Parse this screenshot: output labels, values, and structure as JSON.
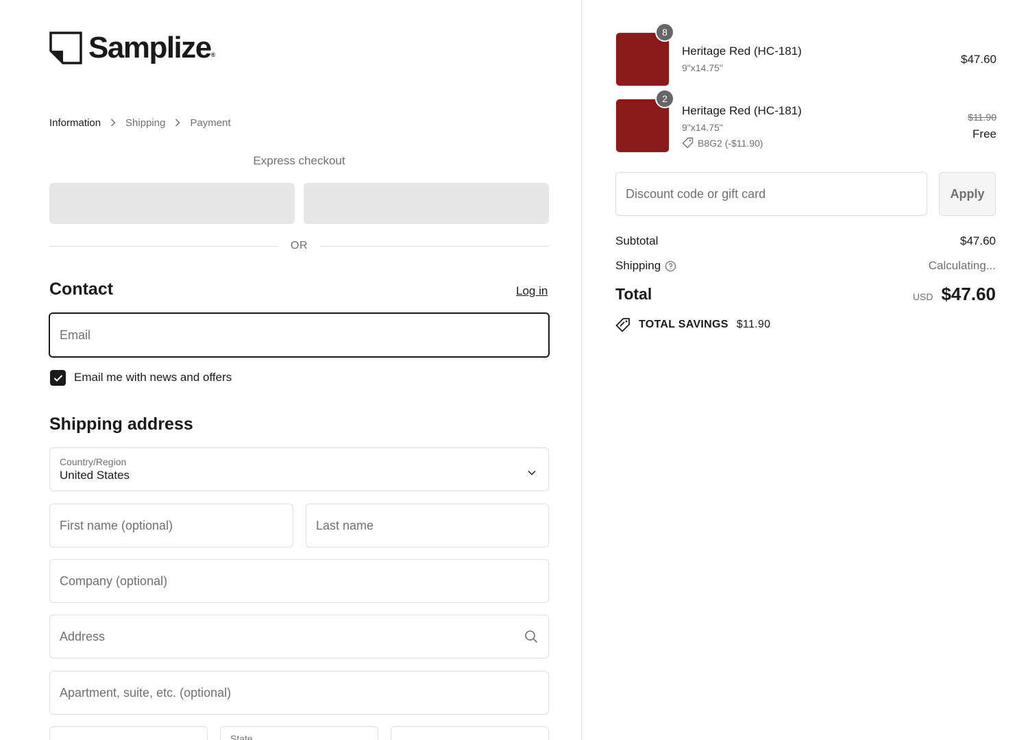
{
  "brand": {
    "name": "Samplize",
    "mark": "®"
  },
  "breadcrumb": [
    "Information",
    "Shipping",
    "Payment"
  ],
  "express": {
    "label": "Express checkout",
    "or": "OR"
  },
  "contact": {
    "title": "Contact",
    "login": "Log in",
    "email_placeholder": "Email",
    "newsletter_label": "Email me with news and offers",
    "newsletter_checked": true
  },
  "shipping": {
    "title": "Shipping address",
    "country_label": "Country/Region",
    "country_value": "United States",
    "first_name": "First name (optional)",
    "last_name": "Last name",
    "company": "Company (optional)",
    "address": "Address",
    "apartment": "Apartment, suite, etc. (optional)",
    "state": "State"
  },
  "cart": {
    "items": [
      {
        "qty": "8",
        "name": "Heritage Red (HC-181)",
        "variant": "9\"x14.75\"",
        "price": "$47.60",
        "color": "#8a1a1a"
      },
      {
        "qty": "2",
        "name": "Heritage Red (HC-181)",
        "variant": "9\"x14.75\"",
        "discount": "B8G2 (-$11.90)",
        "old_price": "$11.90",
        "price": "Free",
        "color": "#8a1a1a"
      }
    ],
    "discount_placeholder": "Discount code or gift card",
    "apply": "Apply",
    "subtotal_label": "Subtotal",
    "subtotal": "$47.60",
    "shipping_label": "Shipping",
    "shipping_value": "Calculating...",
    "total_label": "Total",
    "currency": "USD",
    "total": "$47.60",
    "savings_label": "TOTAL SAVINGS",
    "savings": "$11.90"
  }
}
